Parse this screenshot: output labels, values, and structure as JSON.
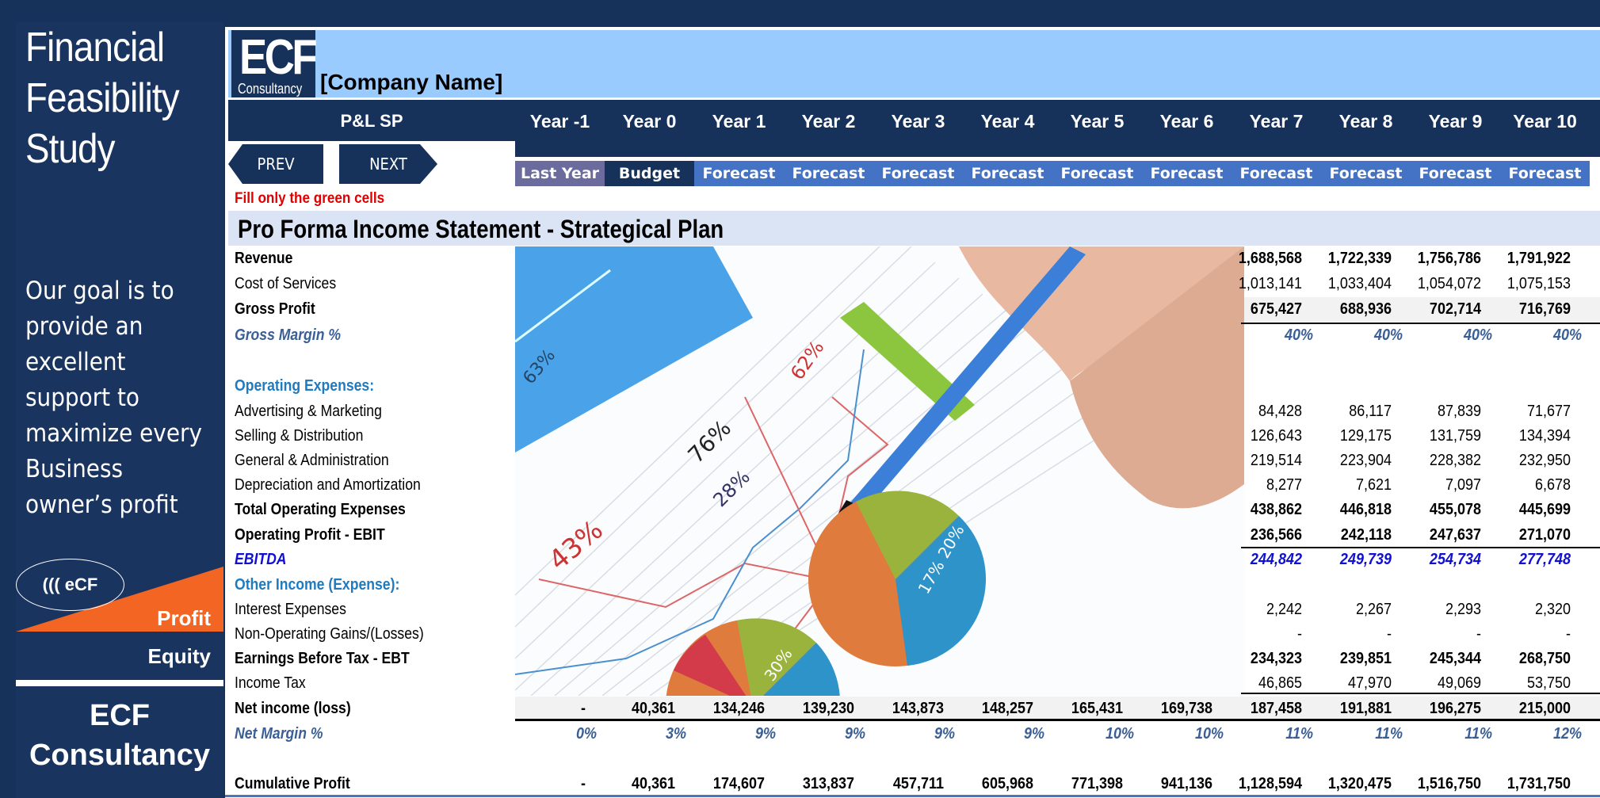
{
  "sidebar": {
    "title": [
      "Financial",
      "Feasibility",
      "Study"
    ],
    "goal_lines": [
      "Our goal is to",
      "provide an",
      "excellent",
      "support to",
      "maximize every",
      "Business",
      "owner’s profit"
    ],
    "logo_oval": "((( eCF",
    "profit_label": "Profit",
    "equity_label": "Equity",
    "brand_lines": [
      "ECF",
      "Consultancy"
    ],
    "colors": {
      "navy": "#1a3460",
      "orange": "#f26522"
    }
  },
  "header": {
    "logo_big": "ECF",
    "logo_small": "Consultancy",
    "company_name": "[Company Name]",
    "sheet_label": "P&L SP",
    "prev_label": "PREV",
    "next_label": "NEXT",
    "fill_note": "Fill only the green cells",
    "title": "Pro Forma Income Statement - Strategical Plan"
  },
  "columns": [
    {
      "year": "Year -1",
      "status": "Last Year",
      "status_color": "#6b6b9e"
    },
    {
      "year": "Year 0",
      "status": "Budget",
      "status_color": "#17325a"
    },
    {
      "year": "Year 1",
      "status": "Forecast",
      "status_color": "#4472c4"
    },
    {
      "year": "Year 2",
      "status": "Forecast",
      "status_color": "#4472c4"
    },
    {
      "year": "Year 3",
      "status": "Forecast",
      "status_color": "#4472c4"
    },
    {
      "year": "Year 4",
      "status": "Forecast",
      "status_color": "#4472c4"
    },
    {
      "year": "Year 5",
      "status": "Forecast",
      "status_color": "#4472c4"
    },
    {
      "year": "Year 6",
      "status": "Forecast",
      "status_color": "#4472c4"
    },
    {
      "year": "Year 7",
      "status": "Forecast",
      "status_color": "#4472c4"
    },
    {
      "year": "Year 8",
      "status": "Forecast",
      "status_color": "#4472c4"
    },
    {
      "year": "Year 9",
      "status": "Forecast",
      "status_color": "#4472c4"
    },
    {
      "year": "Year 10",
      "status": "Forecast",
      "status_color": "#4472c4"
    }
  ],
  "rows": [
    {
      "label": "Revenue",
      "style": "bold",
      "values": [
        "",
        "",
        "",
        "",
        "",
        "",
        "",
        "",
        "1,688,568",
        "1,722,339",
        "1,756,786",
        "1,791,922"
      ]
    },
    {
      "label": "Cost of Services",
      "style": "normal",
      "values": [
        "",
        "",
        "",
        "",
        "",
        "",
        "",
        "",
        "1,013,141",
        "1,033,404",
        "1,054,072",
        "1,075,153"
      ]
    },
    {
      "label": "Gross Profit",
      "style": "bold",
      "values": [
        "",
        "",
        "",
        "",
        "",
        "",
        "",
        "",
        "675,427",
        "688,936",
        "702,714",
        "716,769"
      ]
    },
    {
      "label": "Gross Margin %",
      "style": "italic-blue",
      "values": [
        "",
        "",
        "",
        "",
        "",
        "",
        "",
        "",
        "40%",
        "40%",
        "40%",
        "40%"
      ]
    },
    {
      "label": "",
      "style": "normal",
      "values": []
    },
    {
      "label": "Operating Expenses:",
      "style": "head-blue",
      "values": []
    },
    {
      "label": "Advertising & Marketing",
      "style": "normal",
      "values": [
        "",
        "",
        "",
        "",
        "",
        "",
        "",
        "",
        "84,428",
        "86,117",
        "87,839",
        "71,677"
      ]
    },
    {
      "label": "Selling & Distribution",
      "style": "normal",
      "values": [
        "",
        "",
        "",
        "",
        "",
        "",
        "",
        "",
        "126,643",
        "129,175",
        "131,759",
        "134,394"
      ]
    },
    {
      "label": "General & Administration",
      "style": "normal",
      "values": [
        "",
        "",
        "",
        "",
        "",
        "",
        "",
        "",
        "219,514",
        "223,904",
        "228,382",
        "232,950"
      ]
    },
    {
      "label": "Depreciation and Amortization",
      "style": "normal",
      "values": [
        "",
        "",
        "",
        "",
        "",
        "",
        "",
        "",
        "8,277",
        "7,621",
        "7,097",
        "6,678"
      ]
    },
    {
      "label": "Total Operating Expenses",
      "style": "bold",
      "values": [
        "",
        "",
        "",
        "",
        "",
        "",
        "",
        "",
        "438,862",
        "446,818",
        "455,078",
        "445,699"
      ]
    },
    {
      "label": "Operating Profit - EBIT",
      "style": "bold",
      "values": [
        "",
        "",
        "",
        "",
        "",
        "",
        "",
        "",
        "236,566",
        "242,118",
        "247,637",
        "271,070"
      ]
    },
    {
      "label": "EBITDA",
      "style": "ebitda",
      "values": [
        "",
        "",
        "",
        "",
        "",
        "",
        "",
        "",
        "244,842",
        "249,739",
        "254,734",
        "277,748"
      ]
    },
    {
      "label": "Other Income (Expense):",
      "style": "head-blue",
      "values": []
    },
    {
      "label": "Interest Expenses",
      "style": "normal",
      "values": [
        "",
        "",
        "",
        "",
        "",
        "",
        "",
        "",
        "2,242",
        "2,267",
        "2,293",
        "2,320"
      ]
    },
    {
      "label": "Non-Operating Gains/(Losses)",
      "style": "normal",
      "values": [
        "",
        "",
        "",
        "",
        "",
        "",
        "",
        "",
        "-",
        "-",
        "-",
        "-"
      ]
    },
    {
      "label": "Earnings Before Tax - EBT",
      "style": "bold",
      "values": [
        "",
        "",
        "",
        "",
        "",
        "",
        "",
        "",
        "234,323",
        "239,851",
        "245,344",
        "268,750"
      ]
    },
    {
      "label": "Income Tax",
      "style": "normal",
      "values": [
        "",
        "",
        "",
        "",
        "",
        "",
        "",
        "",
        "46,865",
        "47,970",
        "49,069",
        "53,750"
      ]
    },
    {
      "label": "Net income (loss)",
      "style": "bold",
      "values": [
        "-",
        "40,361",
        "134,246",
        "139,230",
        "143,873",
        "148,257",
        "165,431",
        "169,738",
        "187,458",
        "191,881",
        "196,275",
        "215,000"
      ]
    },
    {
      "label": "Net Margin %",
      "style": "italic-blue",
      "values": [
        "0%",
        "3%",
        "9%",
        "9%",
        "9%",
        "9%",
        "10%",
        "10%",
        "11%",
        "11%",
        "11%",
        "12%"
      ]
    },
    {
      "label": "",
      "style": "normal",
      "values": []
    },
    {
      "label": "Cumulative Profit",
      "style": "bold",
      "values": [
        "-",
        "40,361",
        "174,607",
        "313,837",
        "457,711",
        "605,968",
        "771,398",
        "941,136",
        "1,128,594",
        "1,320,475",
        "1,516,750",
        "1,731,750"
      ]
    }
  ],
  "picture": {
    "description": "hand-with-pen-over-charts",
    "labels": [
      "63%",
      "62%",
      "76%",
      "28%",
      "43%",
      "20%",
      "17%",
      "30%"
    ]
  }
}
